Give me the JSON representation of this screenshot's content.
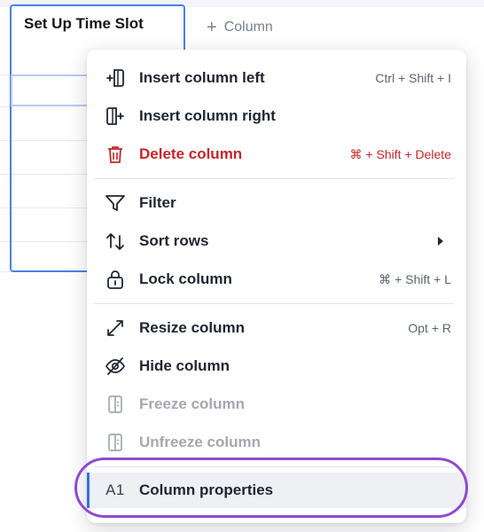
{
  "table": {
    "column_header": "Set Up Time Slot",
    "add_column_label": "Column"
  },
  "menu": {
    "items": [
      {
        "label": "Insert column left",
        "shortcut": "Ctrl + Shift + I",
        "icon": "insert-left-icon"
      },
      {
        "label": "Insert column right",
        "shortcut": "",
        "icon": "insert-right-icon"
      },
      {
        "label": "Delete column",
        "shortcut": "⌘ + Shift + Delete",
        "icon": "trash-icon"
      },
      {
        "label": "Filter",
        "shortcut": "",
        "icon": "filter-icon"
      },
      {
        "label": "Sort rows",
        "shortcut": "",
        "icon": "sort-icon"
      },
      {
        "label": "Lock column",
        "shortcut": "⌘ + Shift + L",
        "icon": "lock-icon"
      },
      {
        "label": "Resize column",
        "shortcut": "Opt + R",
        "icon": "resize-icon"
      },
      {
        "label": "Hide column",
        "shortcut": "",
        "icon": "hide-icon"
      },
      {
        "label": "Freeze column",
        "shortcut": "",
        "icon": "freeze-icon"
      },
      {
        "label": "Unfreeze column",
        "shortcut": "",
        "icon": "unfreeze-icon"
      },
      {
        "label": "Column properties",
        "shortcut": "",
        "icon": "properties-icon",
        "icon_text": "A1"
      }
    ]
  },
  "colors": {
    "accent": "#4c7fe6",
    "danger": "#c2262b",
    "highlight_ring": "#8e4bd1",
    "disabled_text": "#a3a7b0"
  }
}
